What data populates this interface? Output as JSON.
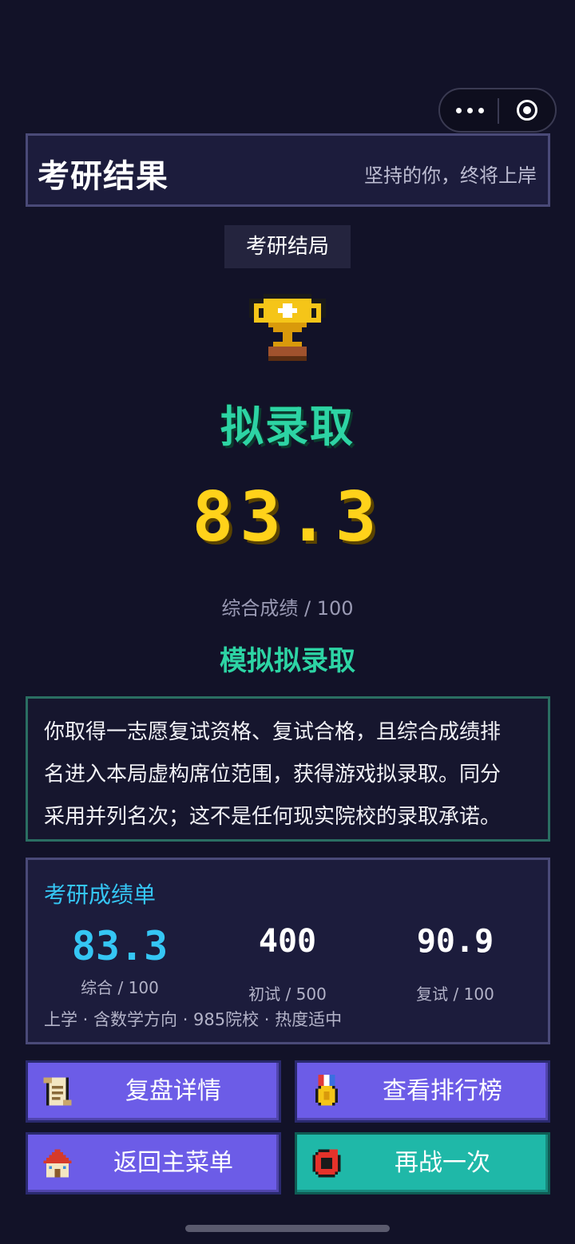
{
  "header": {
    "title": "考研结果",
    "subtitle": "坚持的你，终将上岸"
  },
  "tag": "考研结局",
  "result": {
    "status": "拟录取",
    "score": "83.3",
    "score_caption": "综合成绩 / 100",
    "label": "模拟拟录取"
  },
  "notice": {
    "lines": [
      "你取得一志愿复试资格、复试合格，且综合成绩排",
      "名进入本局虚构席位范围，获得游戏拟录取。同分",
      "采用并列名次；这不是任何现实院校的录取承诺。"
    ]
  },
  "report": {
    "title": "考研成绩单",
    "stats": [
      {
        "value": "83.3",
        "label": "综合 / 100"
      },
      {
        "value": "400",
        "label": "初试 / 500"
      },
      {
        "value": "90.9",
        "label": "复试 / 100"
      }
    ],
    "meta": "上学 · 含数学方向 · 985院校 · 热度适中"
  },
  "buttons": {
    "review": "复盘详情",
    "leaderboard": "查看排行榜",
    "menu": "返回主菜单",
    "retry": "再战一次"
  },
  "icons": {
    "menu": "more-dots-icon",
    "close": "target-icon",
    "trophy": "trophy-icon",
    "review": "scroll-icon",
    "leaderboard": "medal-icon",
    "menu_button": "house-icon",
    "retry": "retry-icon"
  },
  "colors": {
    "background": "#121228",
    "accent_green": "#2dd4a4",
    "accent_yellow": "#ffd21a",
    "accent_blue": "#35c6f4",
    "button_purple": "#6c5ce7",
    "button_teal": "#1fb8a8"
  }
}
